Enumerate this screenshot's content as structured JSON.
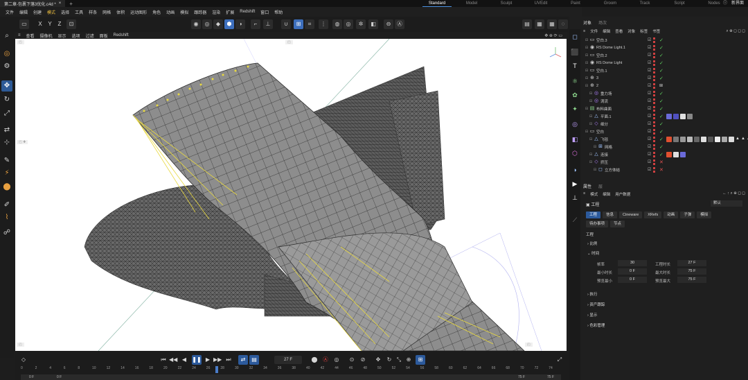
{
  "titlebar": {
    "tab_title": "第二章-包裹下落3优化.c4d *",
    "close": "×",
    "new_tab": "+",
    "layouts": [
      "Standard",
      "Model",
      "Sculpt",
      "UVEdit",
      "Paint",
      "Groom",
      "Track",
      "Script",
      "Nodes"
    ],
    "active_layout": "Standard",
    "new_ui_label": "新界面"
  },
  "menubar": [
    "文件",
    "编辑",
    "创建",
    "模式",
    "选择",
    "工具",
    "样条",
    "网格",
    "体积",
    "运动图形",
    "角色",
    "动画",
    "模拟",
    "跟踪器",
    "渲染",
    "扩展",
    "Redshift",
    "窗口",
    "帮助"
  ],
  "toolbar": {
    "axes": [
      "X",
      "Y",
      "Z"
    ]
  },
  "viewport": {
    "menu": [
      "查看",
      "摄像机",
      "显示",
      "选项",
      "过滤",
      "面板",
      "Redshift"
    ],
    "background": "#ffffff",
    "mesh_color": "#555555",
    "dynamics_color": "#f0e040"
  },
  "timeline": {
    "current_frame": "27 F",
    "ticks": [
      "0",
      "2",
      "4",
      "6",
      "8",
      "10",
      "12",
      "14",
      "16",
      "18",
      "20",
      "22",
      "24",
      "26",
      "28",
      "30",
      "32",
      "34",
      "36",
      "38",
      "40",
      "42",
      "44",
      "46",
      "48",
      "50",
      "52",
      "54",
      "56",
      "58",
      "60",
      "62",
      "64",
      "66",
      "68",
      "70",
      "72",
      "74"
    ],
    "range_start": "0 F",
    "range_start_2": "0 F",
    "range_end": "75 F",
    "range_end_2": "75 F"
  },
  "right_panel": {
    "tabs": [
      "对象",
      "场次"
    ],
    "om_menu": [
      "文件",
      "编辑",
      "查看",
      "对象",
      "标签",
      "书签"
    ],
    "objects": [
      {
        "name": "空白.3",
        "indent": 0
      },
      {
        "name": "RS Dome Light.1",
        "indent": 0
      },
      {
        "name": "空白.2",
        "indent": 0
      },
      {
        "name": "RS Dome Light",
        "indent": 0
      },
      {
        "name": "空白.1",
        "indent": 0
      },
      {
        "name": "3",
        "indent": 0
      },
      {
        "name": "2",
        "indent": 0
      },
      {
        "name": "重力场",
        "indent": 1
      },
      {
        "name": "涡流",
        "indent": 1
      },
      {
        "name": "布料曲面",
        "indent": 0
      },
      {
        "name": "平面.1",
        "indent": 1
      },
      {
        "name": "细分",
        "indent": 1
      },
      {
        "name": "空白",
        "indent": 0
      },
      {
        "name": "飞毯",
        "indent": 1
      },
      {
        "name": "网格",
        "indent": 2
      },
      {
        "name": "连接",
        "indent": 1
      },
      {
        "name": "挤压",
        "indent": 1
      },
      {
        "name": "立方体结",
        "indent": 2
      }
    ],
    "attr_tabs": [
      "属性",
      "层"
    ],
    "attr_menu": [
      "模式",
      "编辑",
      "用户数据"
    ],
    "attr_title": "工程",
    "attr_mode": "默认",
    "buttons_row1": [
      "工程",
      "信息",
      "Cineware",
      "XRefs",
      "动画",
      "子弹",
      "模拟"
    ],
    "buttons_row2": [
      "待办事项",
      "节点"
    ],
    "section_title": "工程",
    "sections": [
      "比例",
      "时间",
      "执行",
      "资产跟踪",
      "显示",
      "色彩管理"
    ],
    "fields": {
      "fps_label": "帧率",
      "fps": "30",
      "project_time_label": "工程时长",
      "project_time": "27 F",
      "min_time_label": "最小时长",
      "min_time": "0 F",
      "max_time_label": "最大时长",
      "max_time": "75 F",
      "preview_min_label": "预览最小",
      "preview_min": "0 F",
      "preview_max_label": "预览最大",
      "preview_max": "75 F"
    }
  }
}
